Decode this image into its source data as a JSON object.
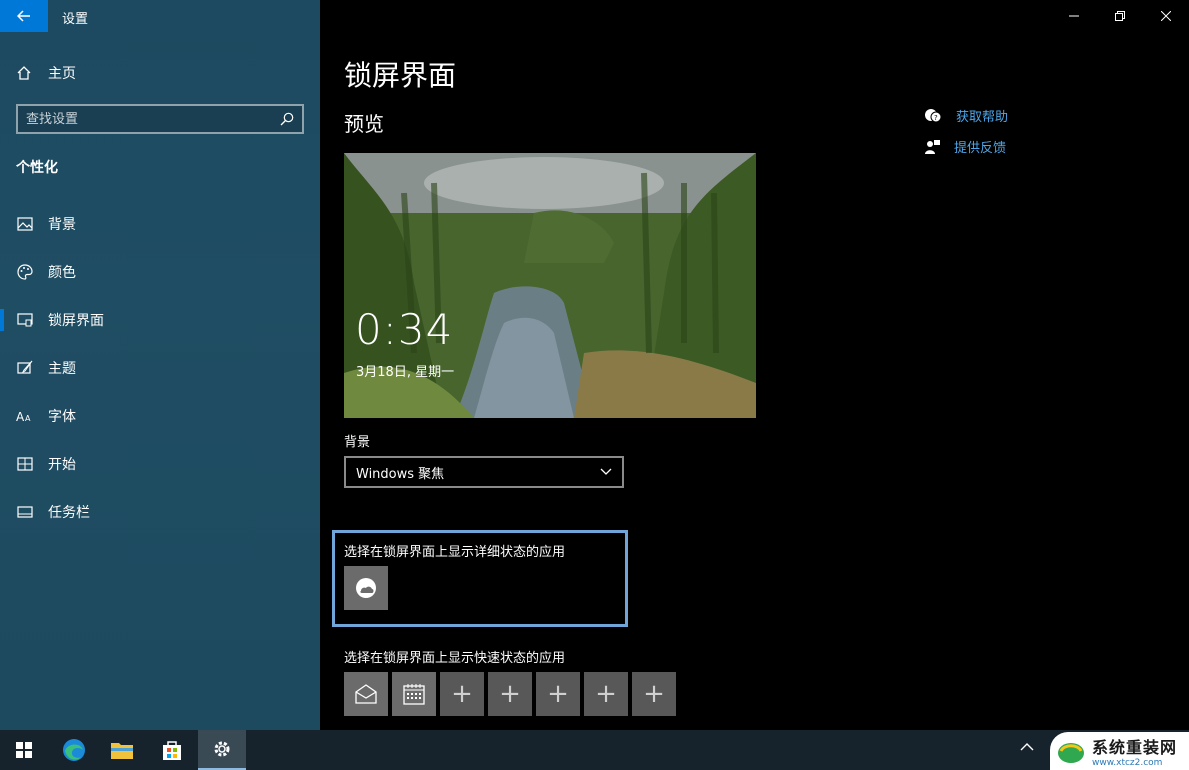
{
  "window": {
    "app_title": "设置"
  },
  "sidebar": {
    "home_label": "主页",
    "search_placeholder": "查找设置",
    "section_title": "个性化",
    "items": [
      {
        "label": "背景",
        "icon": "picture-icon"
      },
      {
        "label": "颜色",
        "icon": "palette-icon"
      },
      {
        "label": "锁屏界面",
        "icon": "lock-screen-icon",
        "active": true
      },
      {
        "label": "主题",
        "icon": "theme-brush-icon"
      },
      {
        "label": "字体",
        "icon": "font-icon"
      },
      {
        "label": "开始",
        "icon": "start-grid-icon"
      },
      {
        "label": "任务栏",
        "icon": "taskbar-icon"
      }
    ]
  },
  "main": {
    "title": "锁屏界面",
    "preview_heading": "预览",
    "preview": {
      "time": "0:34",
      "date": "3月18日, 星期一"
    },
    "background_label": "背景",
    "background_value": "Windows 聚焦",
    "detail_label": "选择在锁屏界面上显示详细状态的应用",
    "quick_label": "选择在锁屏界面上显示快速状态的应用",
    "quick_tiles": [
      "mail-icon",
      "calendar-icon",
      "plus",
      "plus",
      "plus",
      "plus",
      "plus"
    ],
    "quick_plus": "+",
    "help": {
      "get_help": "获取帮助",
      "feedback": "提供反馈"
    }
  },
  "taskbar": {
    "items": [
      "windows-start-icon",
      "edge-icon",
      "file-explorer-icon",
      "store-icon",
      "settings-gear-icon"
    ]
  },
  "watermark": {
    "title": "系统重装网",
    "url": "www.xtcz2.com"
  },
  "colors": {
    "accent": "#0078d7",
    "link": "#4ea6ea",
    "sidebar": "#1f4d63",
    "highlight_border": "#6fa5d8"
  }
}
